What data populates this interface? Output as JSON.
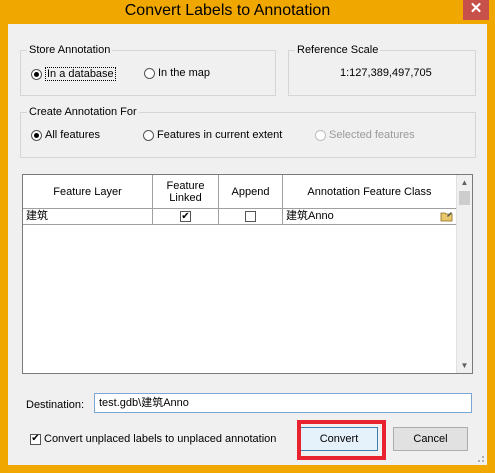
{
  "window": {
    "title": "Convert Labels to Annotation",
    "close_label": "✕"
  },
  "store_annotation": {
    "legend": "Store Annotation",
    "options": [
      {
        "label": "In a database",
        "selected": true
      },
      {
        "label": "In the map",
        "selected": false
      }
    ]
  },
  "reference_scale": {
    "legend": "Reference Scale",
    "value": "1:127,389,497,705"
  },
  "create_for": {
    "legend": "Create Annotation For",
    "options": [
      {
        "label": "All features",
        "selected": true,
        "enabled": true
      },
      {
        "label": "Features in current extent",
        "selected": false,
        "enabled": true
      },
      {
        "label": "Selected features",
        "selected": false,
        "enabled": false
      }
    ]
  },
  "table": {
    "columns": [
      "Feature Layer",
      "Feature Linked",
      "Append",
      "Annotation Feature Class"
    ],
    "rows": [
      {
        "feature_layer": "建筑",
        "feature_linked": true,
        "append": false,
        "annotation_class": "建筑Anno"
      }
    ]
  },
  "destination": {
    "label": "Destination:",
    "value": "test.gdb\\建筑Anno"
  },
  "unplaced": {
    "label": "Convert unplaced labels to unplaced annotation",
    "checked": true
  },
  "buttons": {
    "convert": "Convert",
    "cancel": "Cancel"
  },
  "colors": {
    "titlebar": "#f0a800",
    "highlight_box": "#e8232f"
  },
  "icons": {
    "browse": "folder-edit-icon",
    "scroll_up": "arrow-up-icon",
    "scroll_down": "arrow-down-icon"
  }
}
